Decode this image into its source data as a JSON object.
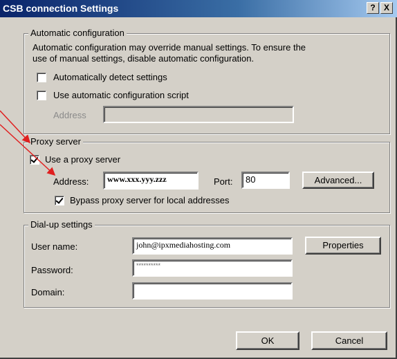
{
  "window": {
    "title": "CSB connection Settings",
    "help_button": "?",
    "close_button": "X"
  },
  "auto_config": {
    "legend": "Automatic configuration",
    "description_line1": "Automatic configuration may override manual settings.  To ensure the",
    "description_line2": "use of manual settings, disable automatic configuration.",
    "detect_label": "Automatically detect settings",
    "detect_checked": false,
    "script_label": "Use automatic configuration script",
    "script_checked": false,
    "address_label": "Address",
    "address_value": ""
  },
  "proxy": {
    "legend": "Proxy server",
    "use_proxy_label": "Use a proxy server",
    "use_proxy_checked": true,
    "address_label": "Address:",
    "address_value": "www.xxx.yyy.zzz",
    "port_label": "Port:",
    "port_value": "80",
    "advanced_label": "Advanced...",
    "bypass_label": "Bypass proxy server for local addresses",
    "bypass_checked": true
  },
  "dialup": {
    "legend": "Dial-up settings",
    "username_label": "User name:",
    "username_value": "john@ipxmediahosting.com",
    "password_label": "Password:",
    "password_value": "**********",
    "domain_label": "Domain:",
    "domain_value": "",
    "properties_label": "Properties"
  },
  "footer": {
    "ok_label": "OK",
    "cancel_label": "Cancel"
  },
  "colors": {
    "annotation_arrow": "#e02020",
    "titlebar": "#0a246a"
  }
}
